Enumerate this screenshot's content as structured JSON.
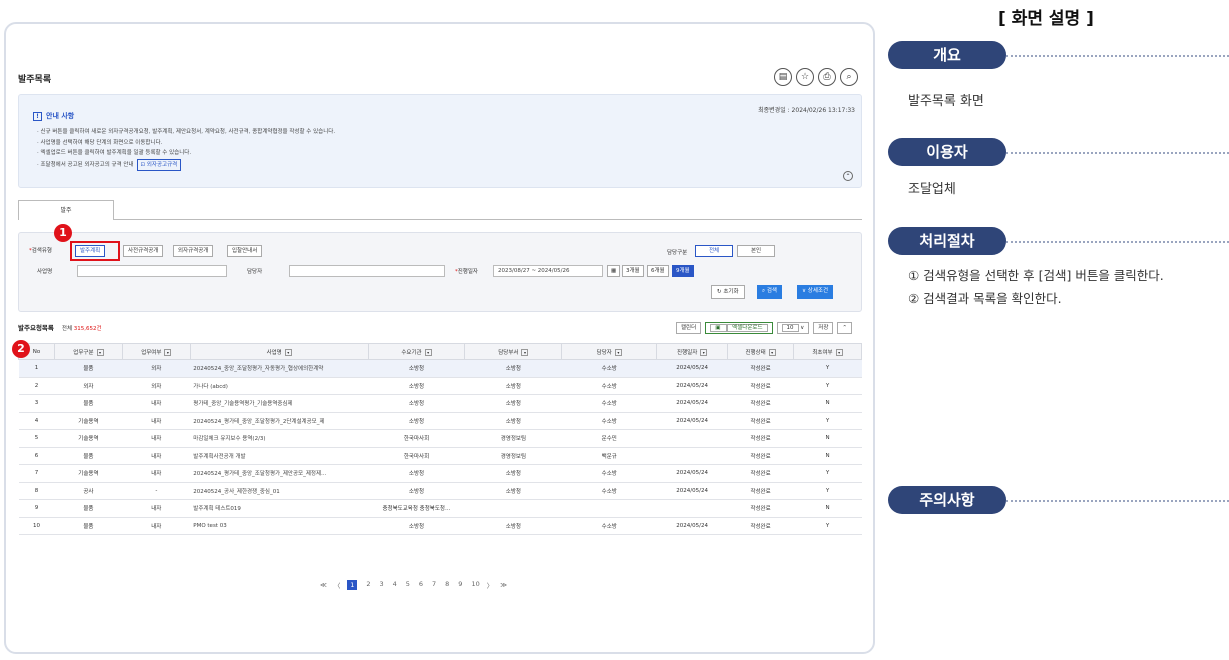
{
  "screen": {
    "title": "발주목록",
    "title_icons": [
      "print-icon",
      "star-icon",
      "printer-icon",
      "search-zoom-icon"
    ],
    "guide": {
      "heading": "안내 사항",
      "updated": "최종변경일 : 2024/02/26 13:17:33",
      "lines": [
        "신규 버튼을 클릭하여 새로운 외자규격공개요청, 발주계획, 제안요청서, 계약요청, 사전규격, 종합계약협정을 작성할 수 있습니다.",
        "사업명을 선택하여 해당 단계의 화면으로 이동합니다.",
        "엑셀업로드 버튼을 클릭하여 발주계획을 일괄 등록할 수 있습니다.",
        "조달청에서 공고된 외자공고의 규격 안내"
      ],
      "tag": "외자공고규격"
    },
    "tab": "발주",
    "search": {
      "type_label": "검색유형",
      "type_buttons": [
        "발주계획",
        "사전규격공개",
        "외자규격공개",
        "입찰안내서"
      ],
      "charge_label": "담당구분",
      "charge_buttons": [
        "전체",
        "본인"
      ],
      "project_label": "사업명",
      "manager_label": "담당자",
      "period_label": "진행일자",
      "period_value": "2023/08/27  ~  2024/05/26",
      "period_buttons": [
        "3개월",
        "6개월",
        "9개월"
      ],
      "reset": "초기화",
      "search": "검색",
      "detail": "상세조건"
    },
    "list": {
      "title": "발주요청목록",
      "total_prefix": "전체",
      "total": "315,652건",
      "tools": [
        "캘린더",
        "엑셀다운로드",
        "10",
        "저장"
      ],
      "columns": [
        "No",
        "업무구분",
        "업무여부",
        "사업명",
        "수요기관",
        "담당부서",
        "담당자",
        "진행일자",
        "진행상태",
        "최초여부"
      ],
      "rows": [
        [
          "1",
          "물품",
          "외자",
          "20240524_중앙_조달청평가_자동평가_협상에의한계약",
          "소방청",
          "소방청",
          "수소방",
          "2024/05/24",
          "작성완료",
          "Y"
        ],
        [
          "2",
          "외자",
          "외자",
          "가나다 (abcd)",
          "소방청",
          "소방청",
          "수소방",
          "2024/05/24",
          "작성완료",
          "Y"
        ],
        [
          "3",
          "물품",
          "내자",
          "평가테_중앙_기술용역평가_기술용역중심제",
          "소방청",
          "소방청",
          "수소방",
          "2024/05/24",
          "작성완료",
          "N"
        ],
        [
          "4",
          "기술용역",
          "내자",
          "20240524_평가테_중앙_조달청평가_2단계설계공모_제",
          "소방청",
          "소방청",
          "수소방",
          "2024/05/24",
          "작성완료",
          "Y"
        ],
        [
          "5",
          "기술용역",
          "내자",
          "마감일체크 유지보수 용역(2/3)",
          "한국마사회",
          "경영정보팀",
          "운수민",
          "",
          "작성완료",
          "N"
        ],
        [
          "6",
          "물품",
          "내자",
          "발주계획사전공개 개발",
          "한국마사회",
          "경영정보팀",
          "백운규",
          "",
          "작성완료",
          "N"
        ],
        [
          "7",
          "기술용역",
          "내자",
          "20240524_평가테_중앙_조달청평가_제안공모_제정제…",
          "소방청",
          "소방청",
          "수소방",
          "2024/05/24",
          "작성완료",
          "Y"
        ],
        [
          "8",
          "공사",
          "-",
          "20240524_공사_제한경쟁_중심_01",
          "소방청",
          "소방청",
          "수소방",
          "2024/05/24",
          "작성완료",
          "Y"
        ],
        [
          "9",
          "물품",
          "내자",
          "발주계획 테스트019",
          "충청북도교육청 충청북도청…",
          "",
          "",
          "",
          "작성완료",
          "N"
        ],
        [
          "10",
          "물품",
          "내자",
          "PMO test 03",
          "소방청",
          "소방청",
          "수소방",
          "2024/05/24",
          "작성완료",
          "Y"
        ]
      ]
    },
    "pager": {
      "first": "≪",
      "prev": "〈",
      "pages": [
        "1",
        "2",
        "3",
        "4",
        "5",
        "6",
        "7",
        "8",
        "9",
        "10"
      ],
      "current": "1",
      "next": "〉",
      "last": "≫"
    },
    "badges": [
      "1",
      "2"
    ]
  },
  "panel": {
    "title": "[ 화면 설명 ]",
    "overview_label": "개요",
    "overview_text": "발주목록 화면",
    "user_label": "이용자",
    "user_text": "조달업체",
    "process_label": "처리절차",
    "steps": [
      "① 검색유형을 선택한 후 [검색] 버튼을 클릭한다.",
      "② 검색결과 목록을 확인한다."
    ],
    "caution_label": "주의사항"
  },
  "colors": {
    "accent": "#2a56c6",
    "highlight": "#e0121a",
    "pill": "#2f4578"
  }
}
